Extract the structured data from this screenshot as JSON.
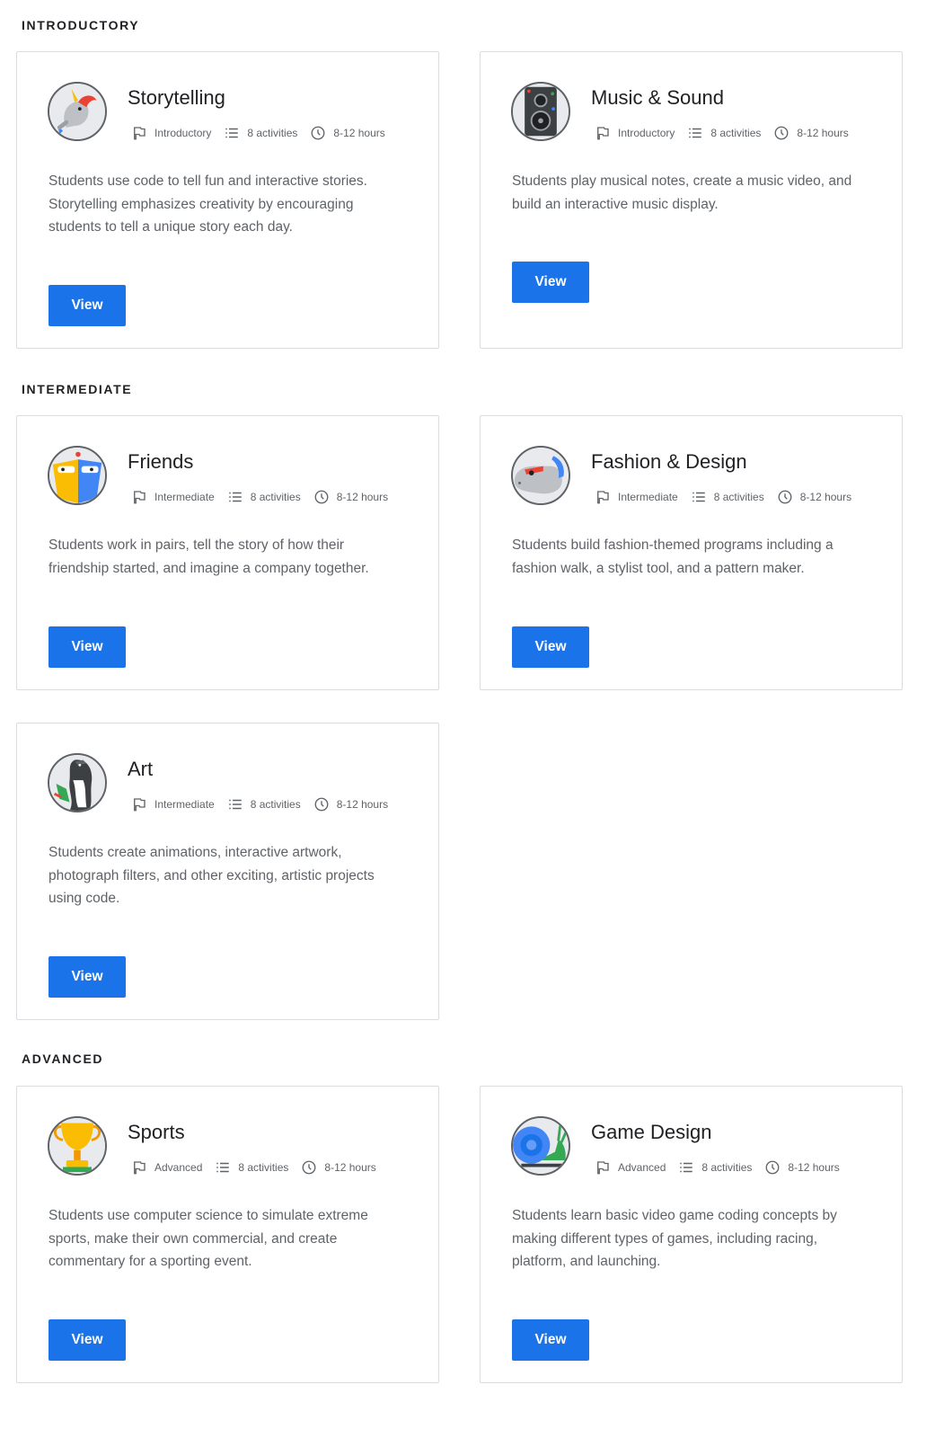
{
  "colors": {
    "accent": "#1a73e8",
    "text_primary": "#202124",
    "text_secondary": "#5f6368",
    "border": "#dadce0"
  },
  "sections": {
    "introductory": "INTRODUCTORY",
    "intermediate": "INTERMEDIATE",
    "advanced": "ADVANCED"
  },
  "meta_icons": {
    "level": "flag-icon",
    "activities": "list-icon",
    "time": "clock-icon"
  },
  "cards": {
    "storytelling": {
      "title": "Storytelling",
      "icon": "unicorn-icon",
      "level": "Introductory",
      "activities": "8 activities",
      "time": "8-12 hours",
      "description": "Students use code to tell fun and interactive stories. Storytelling emphasizes creativity by encouraging students to tell a unique story each day.",
      "button": "View"
    },
    "music": {
      "title": "Music & Sound",
      "icon": "speaker-icon",
      "level": "Introductory",
      "activities": "8 activities",
      "time": "8-12 hours",
      "description": "Students play musical notes, create a music video, and build an interactive music display.",
      "button": "View"
    },
    "friends": {
      "title": "Friends",
      "icon": "friends-robots-icon",
      "level": "Intermediate",
      "activities": "8 activities",
      "time": "8-12 hours",
      "description": "Students work in pairs, tell the story of how their friendship started, and imagine a company together.",
      "button": "View"
    },
    "fashion": {
      "title": "Fashion & Design",
      "icon": "hippo-sunglasses-icon",
      "level": "Intermediate",
      "activities": "8 activities",
      "time": "8-12 hours",
      "description": "Students build fashion-themed programs including a fashion walk, a stylist tool, and a pattern maker.",
      "button": "View"
    },
    "art": {
      "title": "Art",
      "icon": "penguin-paint-icon",
      "level": "Intermediate",
      "activities": "8 activities",
      "time": "8-12 hours",
      "description": "Students create animations, interactive artwork, photograph filters, and other exciting, artistic projects using code.",
      "button": "View"
    },
    "sports": {
      "title": "Sports",
      "icon": "trophy-icon",
      "level": "Advanced",
      "activities": "8 activities",
      "time": "8-12 hours",
      "description": "Students use computer science to simulate extreme sports, make their own commercial, and create commentary for a sporting event.",
      "button": "View"
    },
    "game": {
      "title": "Game Design",
      "icon": "snail-icon",
      "level": "Advanced",
      "activities": "8 activities",
      "time": "8-12 hours",
      "description": "Students learn basic video game coding concepts by making different types of games, including racing, platform, and launching.",
      "button": "View"
    }
  }
}
